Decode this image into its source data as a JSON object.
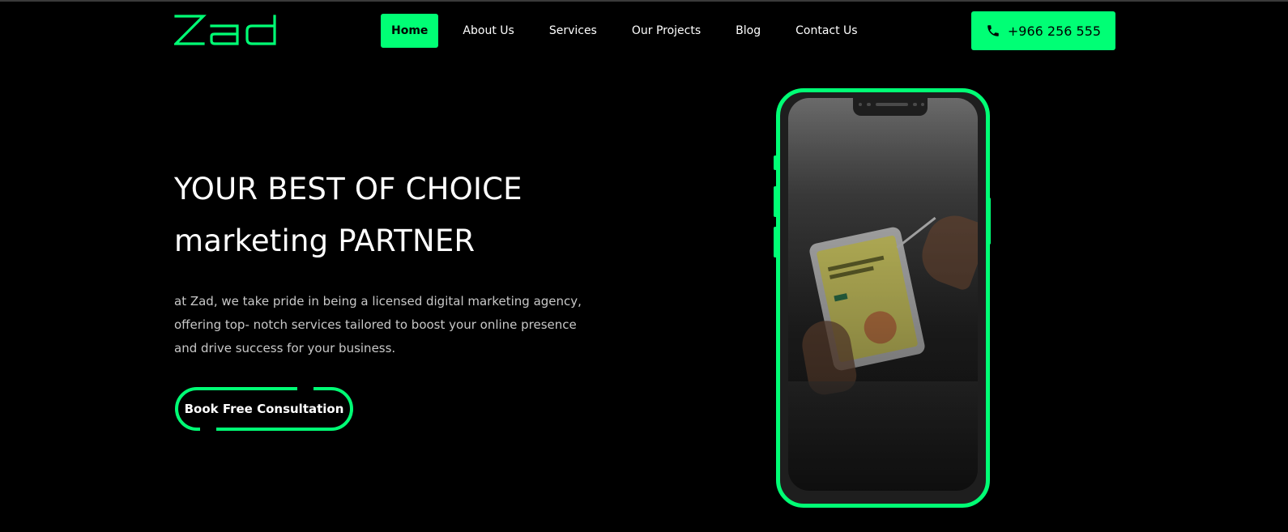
{
  "brand": {
    "logo_text": "Zad",
    "accent_color": "#00ff75",
    "background_color": "#000000"
  },
  "nav": {
    "items": [
      {
        "label": "Home",
        "active": true
      },
      {
        "label": "About Us",
        "active": false
      },
      {
        "label": "Services",
        "active": false
      },
      {
        "label": "Our Projects",
        "active": false
      },
      {
        "label": "Blog",
        "active": false
      },
      {
        "label": "Contact Us",
        "active": false
      }
    ]
  },
  "contact_button": {
    "icon": "phone-icon",
    "label": "+966 256 555"
  },
  "hero": {
    "title_line1": "YOUR BEST OF CHOICE",
    "title_line2": "marketing PARTNER",
    "description": "at Zad, we take pride in being a licensed digital marketing agency, offering top- notch services tailored to boost your online presence and drive success for your business.",
    "cta_label": "Book Free Consultation"
  },
  "phone_mockup": {
    "image": "hands-holding-tablet-photo"
  }
}
